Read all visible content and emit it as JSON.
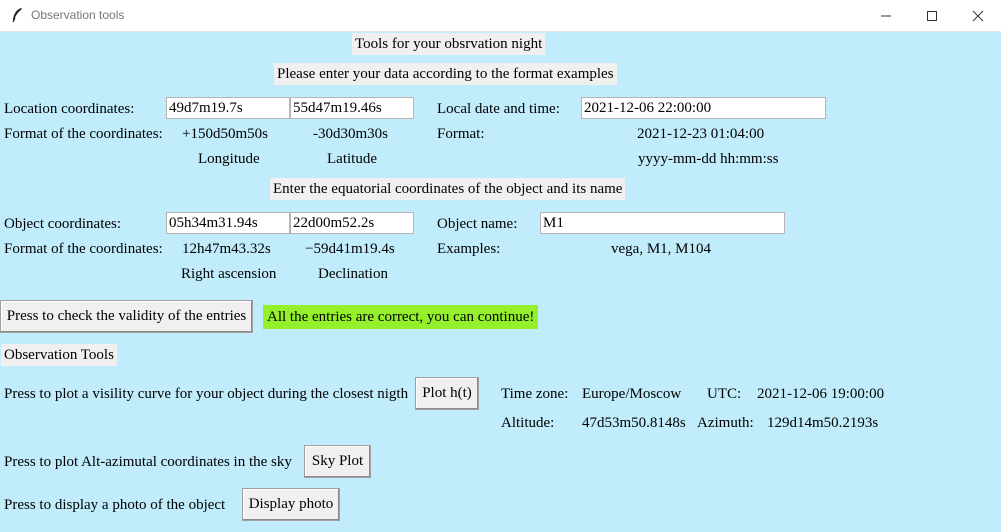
{
  "window": {
    "title": "Observation tools"
  },
  "header": {
    "heading": "Tools for your obsrvation night",
    "instructions": "Please enter your data according to the format examples"
  },
  "location": {
    "label": "Location coordinates:",
    "longitude_value": "49d7m19.7s",
    "latitude_value": "55d47m19.46s",
    "format_label": "Format of the coordinates:",
    "longitude_example": "+150d50m50s",
    "latitude_example": "-30d30m30s",
    "longitude_caption": "Longitude",
    "latitude_caption": "Latitude"
  },
  "datetime": {
    "label": "Local date and time:",
    "value": "2021-12-06 22:00:00",
    "format_label": "Format:",
    "example": "2021-12-23 01:04:00",
    "pattern": "yyyy-mm-dd hh:mm:ss"
  },
  "object_section": {
    "heading": "Enter the equatorial coordinates of the object and its name"
  },
  "object": {
    "label": "Object coordinates:",
    "ra_value": "05h34m31.94s",
    "dec_value": "22d00m52.2s",
    "format_label": "Format of the coordinates:",
    "ra_example": "12h47m43.32s",
    "dec_example": "−59d41m19.4s",
    "ra_caption": "Right ascension",
    "dec_caption": "Declination",
    "name_label": "Object name:",
    "name_value": "M1",
    "examples_label": "Examples:",
    "examples": "vega, M1, M104"
  },
  "validation": {
    "button_label": "Press to check the validity of the entries",
    "message": "All the entries are correct, you can continue!",
    "message_color": "#93f02b"
  },
  "tools": {
    "heading": "Observation Tools",
    "visibility_text": "Press to plot a visility curve for your object during the closest nigth",
    "plot_button": "Plot h(t)",
    "timezone_label": "Time zone:",
    "timezone_value": "Europe/Moscow",
    "utc_label": "UTC:",
    "utc_value": "2021-12-06 19:00:00",
    "altitude_label": "Altitude:",
    "altitude_value": "47d53m50.8148s",
    "azimuth_label": "Azimuth:",
    "azimuth_value": "129d14m50.2193s",
    "sky_text": "Press to plot Alt-azimutal coordinates in the sky",
    "sky_button": "Sky Plot",
    "photo_text": "Press to display a photo of the object",
    "photo_button": "Display photo"
  },
  "colors": {
    "background": "#c0ecfc",
    "label_bg": "#f0f0f0"
  },
  "icons": {
    "app": "feather-icon",
    "minimize": "minimize-icon",
    "maximize": "maximize-icon",
    "close": "close-icon"
  }
}
